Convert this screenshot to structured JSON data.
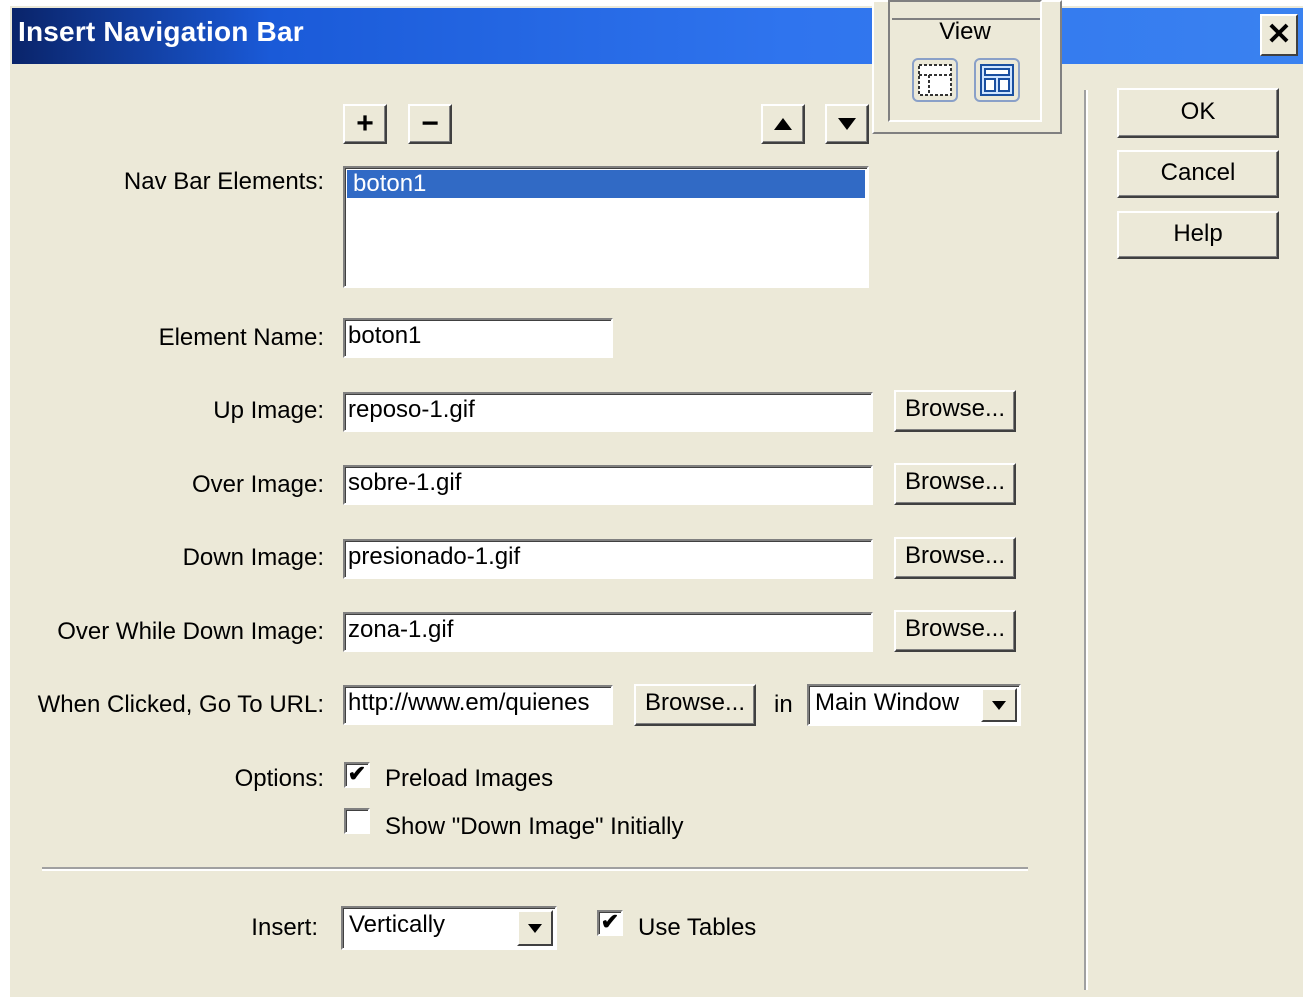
{
  "dialog": {
    "title": "Insert Navigation Bar"
  },
  "view_panel": {
    "label": "View"
  },
  "buttons": {
    "ok": "OK",
    "cancel": "Cancel",
    "help": "Help",
    "browse": "Browse..."
  },
  "labels": {
    "nav_bar_elements": "Nav Bar Elements:",
    "element_name": "Element Name:",
    "up_image": "Up Image:",
    "over_image": "Over Image:",
    "down_image": "Down Image:",
    "over_while_down_image": "Over While Down Image:",
    "when_clicked": "When Clicked, Go To URL:",
    "in": "in",
    "options": "Options:",
    "insert": "Insert:"
  },
  "nav_bar_elements": [
    "boton1"
  ],
  "fields": {
    "element_name": "boton1",
    "up_image": "reposo-1.gif",
    "over_image": "sobre-1.gif",
    "down_image": "presionado-1.gif",
    "over_while_down_image": "zona-1.gif",
    "url": "http://www.em/quienes"
  },
  "selects": {
    "target_window": "Main Window",
    "insert": "Vertically"
  },
  "options": {
    "preload_images": {
      "label": "Preload Images",
      "checked": true
    },
    "show_down_image": {
      "label": "Show \"Down Image\" Initially",
      "checked": false
    },
    "use_tables": {
      "label": "Use Tables",
      "checked": true
    }
  },
  "colors": {
    "title_bar": "#2f74ee",
    "dialog_bg": "#ece9d8",
    "selection": "#316ac5"
  }
}
